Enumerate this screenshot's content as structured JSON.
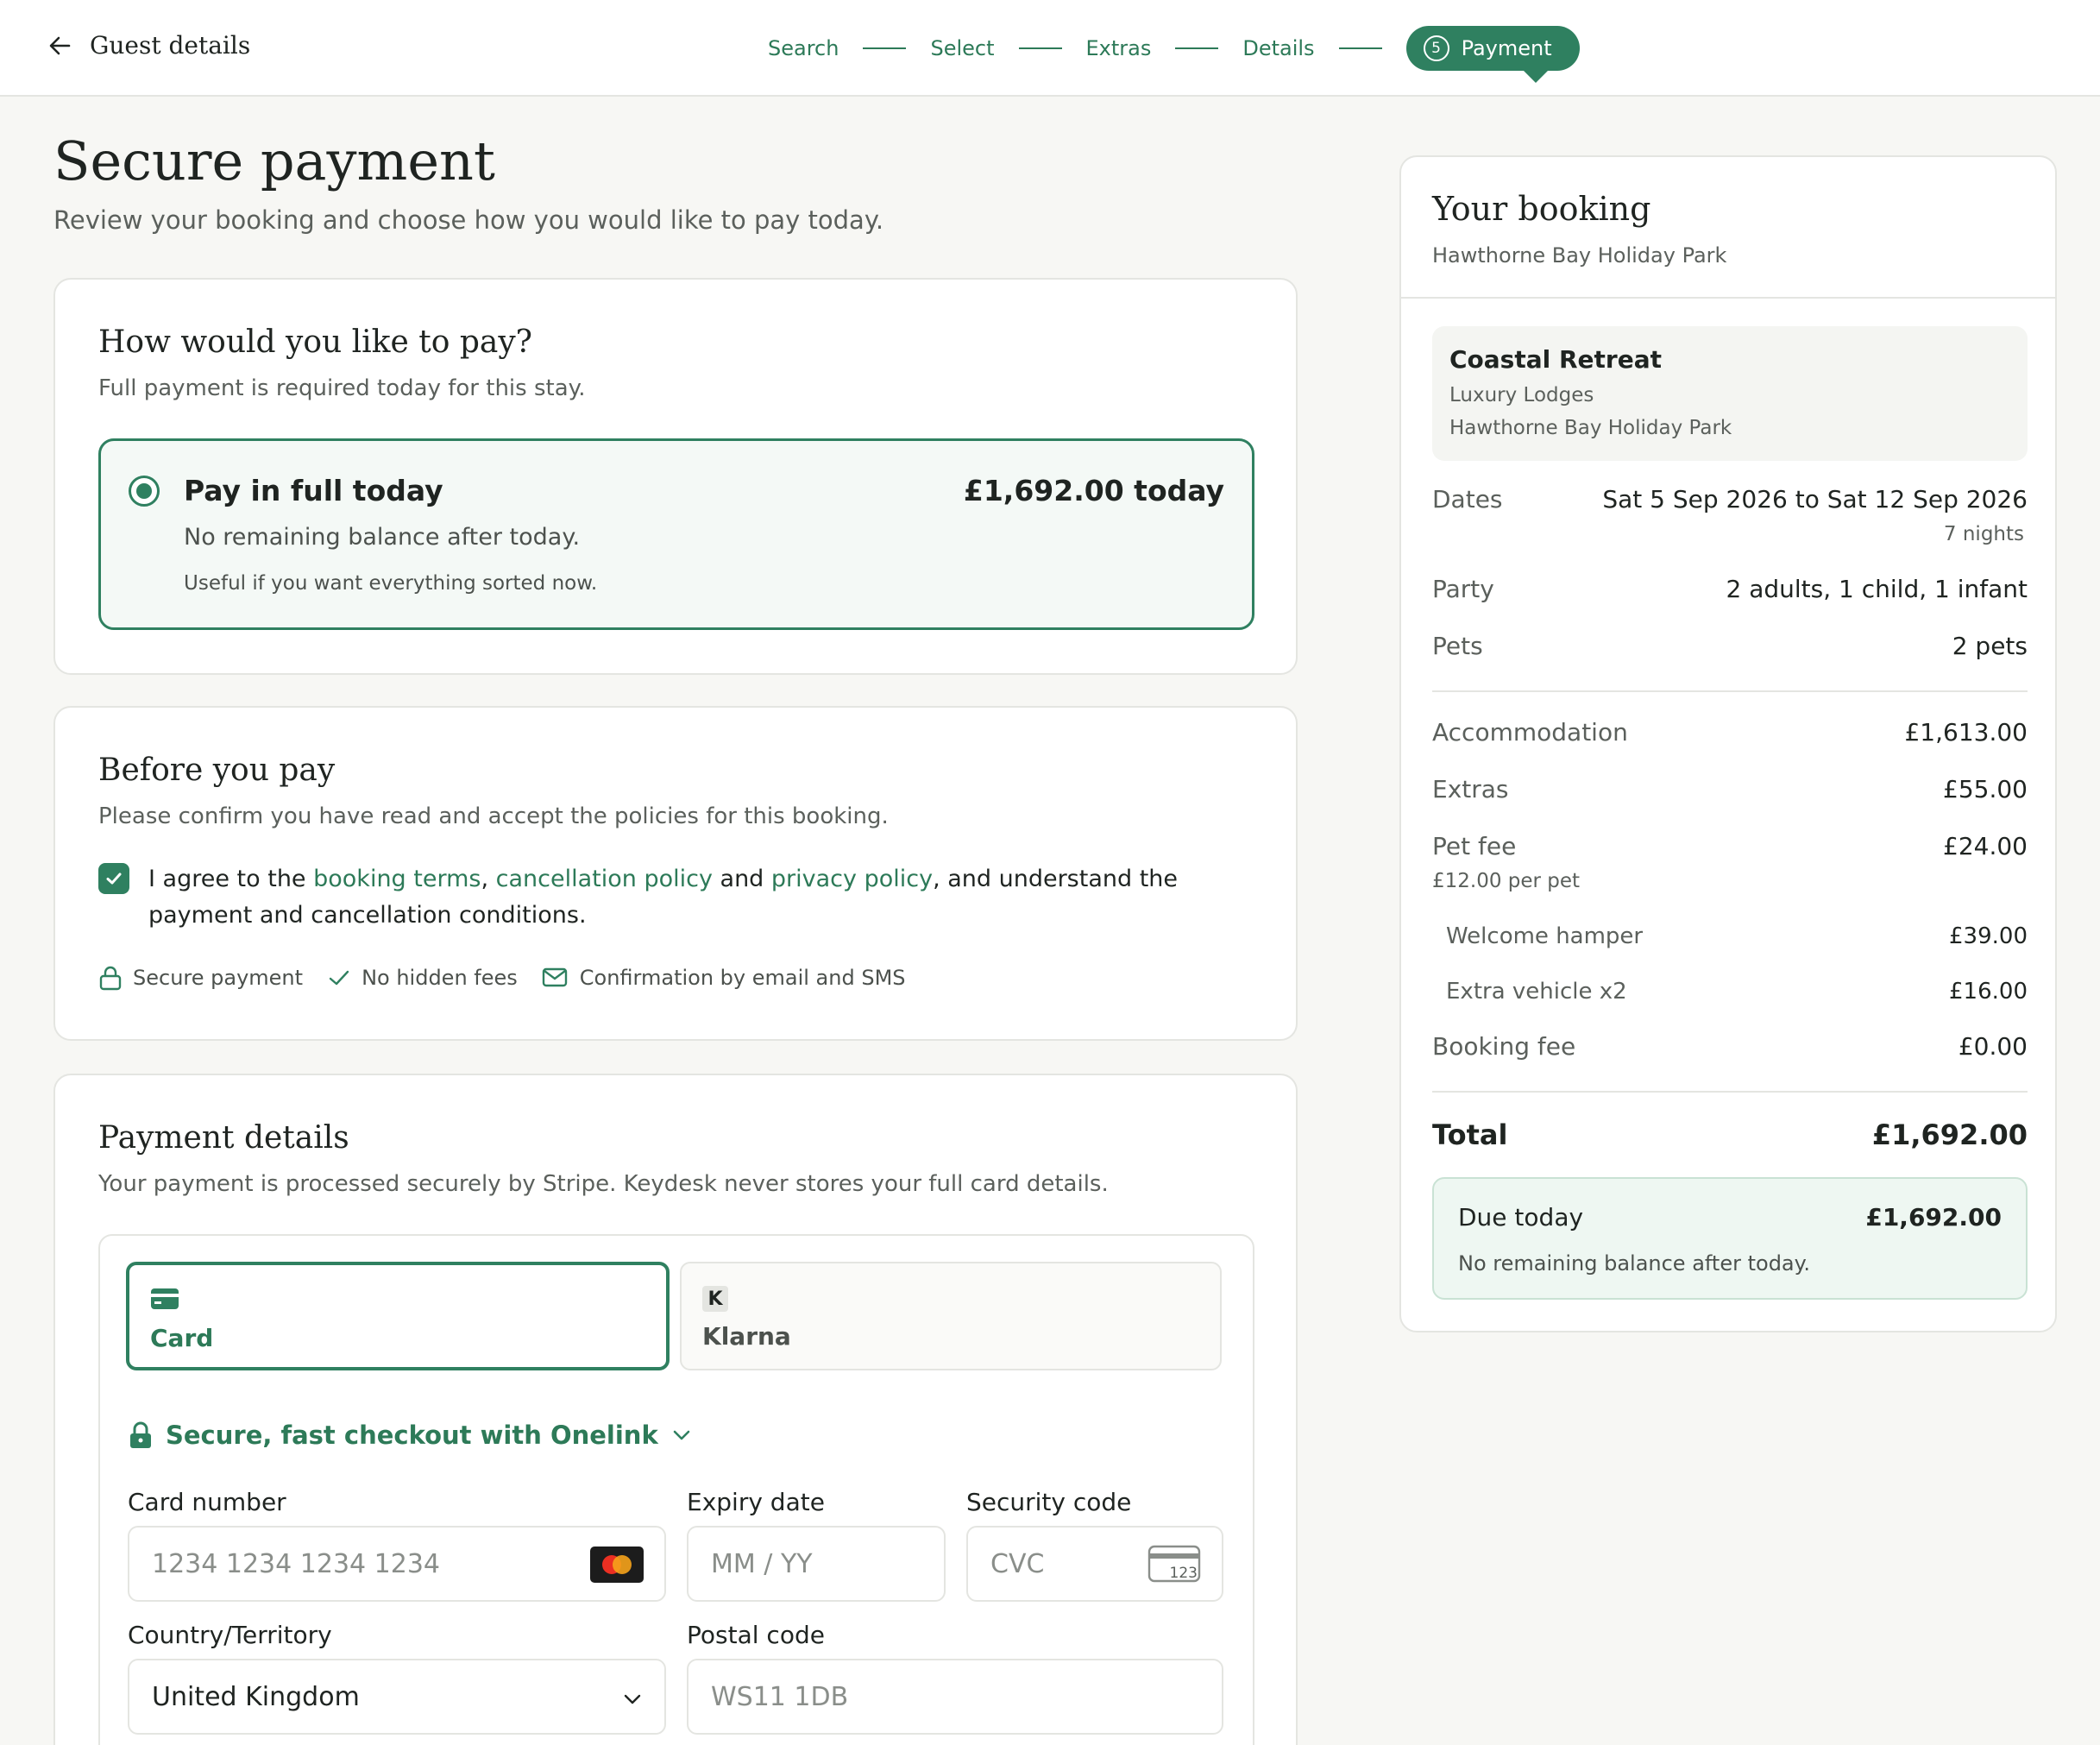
{
  "header": {
    "back_label": "Guest details",
    "steps": [
      "Search",
      "Select",
      "Extras",
      "Details"
    ],
    "active_step_number": "5",
    "active_step_label": "Payment"
  },
  "page": {
    "title": "Secure payment",
    "subtitle": "Review your booking and choose how you would like to pay today."
  },
  "pay_option": {
    "title": "How would you like to pay?",
    "subtitle": "Full payment is required today for this stay.",
    "option_title": "Pay in full today",
    "option_price": "£1,692.00 today",
    "option_line1": "No remaining balance after today.",
    "option_line2": "Useful if you want everything sorted now."
  },
  "before": {
    "title": "Before you pay",
    "subtitle": "Please confirm you have read and accept the policies for this booking.",
    "agree_prefix": "I agree to the ",
    "link_terms": "booking terms",
    "comma": ", ",
    "link_cancel": "cancellation policy",
    "and": " and ",
    "link_privacy": "privacy policy",
    "agree_suffix": ", and understand the payment and cancellation conditions.",
    "trust": [
      "Secure payment",
      "No hidden fees",
      "Confirmation by email and SMS"
    ]
  },
  "payment_details": {
    "title": "Payment details",
    "subtitle": "Your payment is processed securely by Stripe. Keydesk never stores your full card details.",
    "method_card": "Card",
    "method_klarna": "Klarna",
    "klarna_glyph": "K",
    "onelink": "Secure, fast checkout with Onelink",
    "card_number_label": "Card number",
    "card_number_placeholder": "1234 1234 1234 1234",
    "expiry_label": "Expiry date",
    "expiry_placeholder": "MM / YY",
    "cvc_label": "Security code",
    "cvc_placeholder": "CVC",
    "cvc_icon_text": "123",
    "country_label": "Country/Territory",
    "country_value": "United Kingdom",
    "postal_label": "Postal code",
    "postal_placeholder": "WS11 1DB"
  },
  "summary": {
    "title": "Your booking",
    "park": "Hawthorne Bay Holiday Park",
    "unit_name": "Coastal Retreat",
    "unit_type": "Luxury Lodges",
    "unit_park": "Hawthorne Bay Holiday Park",
    "dates_label": "Dates",
    "dates_value": "Sat 5 Sep 2026 to Sat 12 Sep 2026",
    "nights": "7 nights",
    "party_label": "Party",
    "party_value": "2 adults, 1 child, 1 infant",
    "pets_label": "Pets",
    "pets_value": "2 pets",
    "accommodation_label": "Accommodation",
    "accommodation_value": "£1,613.00",
    "extras_label": "Extras",
    "extras_value": "£55.00",
    "pet_fee_label": "Pet fee",
    "pet_fee_value": "£24.00",
    "pet_fee_note": "£12.00 per pet",
    "hamper_label": "Welcome hamper",
    "hamper_value": "£39.00",
    "vehicle_label": "Extra vehicle x2",
    "vehicle_value": "£16.00",
    "booking_fee_label": "Booking fee",
    "booking_fee_value": "£0.00",
    "total_label": "Total",
    "total_value": "£1,692.00",
    "due_label": "Due today",
    "due_value": "£1,692.00",
    "due_note": "No remaining balance after today."
  },
  "colors": {
    "accent": "#2f8060",
    "link": "#2d7a58",
    "background": "#f7f7f4",
    "due_bg": "#eef7f2"
  }
}
